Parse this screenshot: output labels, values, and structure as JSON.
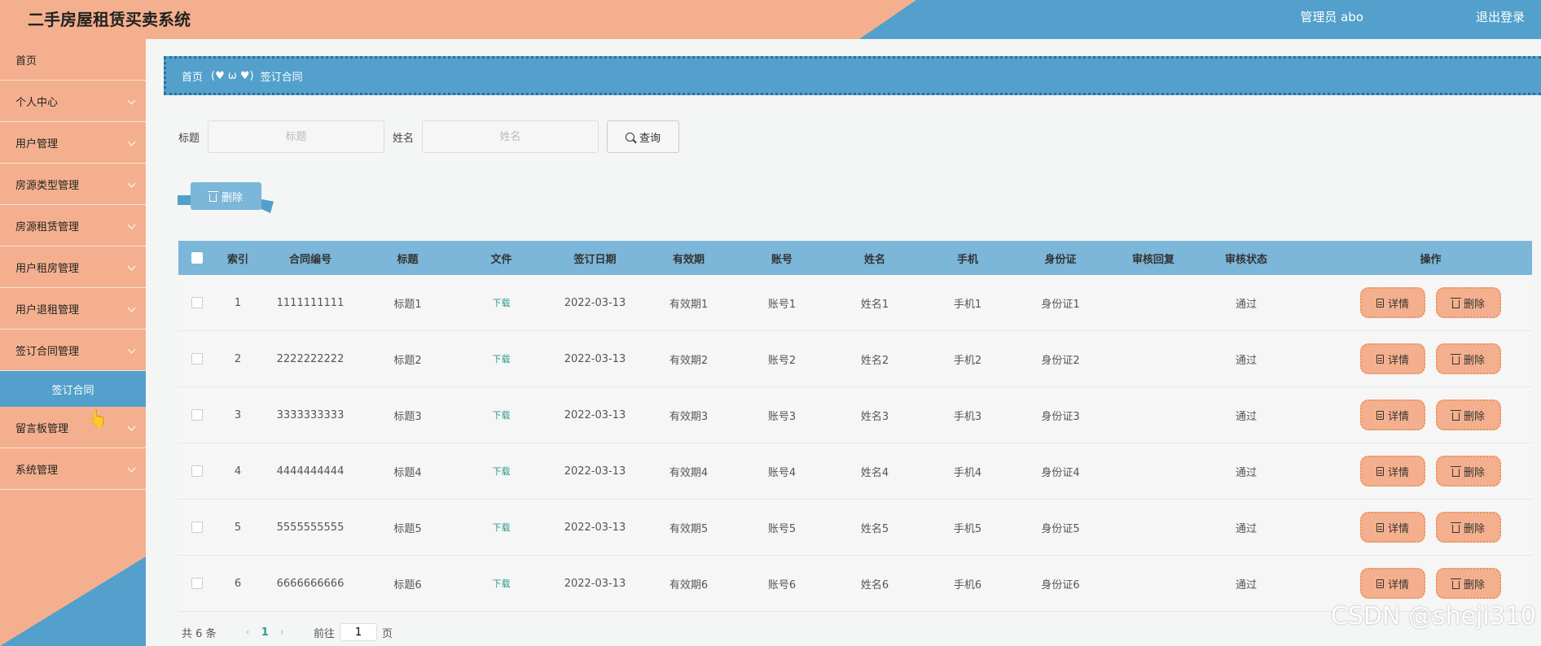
{
  "header": {
    "title": "二手房屋租赁买卖系统",
    "user": "管理员 abo",
    "logout": "退出登录"
  },
  "sidebar": {
    "items": [
      {
        "label": "首页",
        "has_children": false
      },
      {
        "label": "个人中心",
        "has_children": true
      },
      {
        "label": "用户管理",
        "has_children": true
      },
      {
        "label": "房源类型管理",
        "has_children": true
      },
      {
        "label": "房源租赁管理",
        "has_children": true
      },
      {
        "label": "用户租房管理",
        "has_children": true
      },
      {
        "label": "用户退租管理",
        "has_children": true
      },
      {
        "label": "签订合同管理",
        "has_children": true
      },
      {
        "label": "留言板管理",
        "has_children": true
      },
      {
        "label": "系统管理",
        "has_children": true
      }
    ],
    "active_sub": "签订合同"
  },
  "breadcrumb": {
    "home": "首页",
    "separator": "(♥ ω ♥)",
    "current": "签订合同"
  },
  "search": {
    "title_label": "标题",
    "title_placeholder": "标题",
    "name_label": "姓名",
    "name_placeholder": "姓名",
    "query_label": "查询"
  },
  "bulk_delete_label": "删除",
  "table": {
    "columns": [
      "索引",
      "合同编号",
      "标题",
      "文件",
      "签订日期",
      "有效期",
      "账号",
      "姓名",
      "手机",
      "身份证",
      "审核回复",
      "审核状态",
      "操作"
    ],
    "rows": [
      {
        "index": "1",
        "contract_no": "1111111111",
        "title": "标题1",
        "file": "下载",
        "date": "2022-03-13",
        "valid": "有效期1",
        "account": "账号1",
        "name": "姓名1",
        "phone": "手机1",
        "id_card": "身份证1",
        "reply": "",
        "status": "通过"
      },
      {
        "index": "2",
        "contract_no": "2222222222",
        "title": "标题2",
        "file": "下载",
        "date": "2022-03-13",
        "valid": "有效期2",
        "account": "账号2",
        "name": "姓名2",
        "phone": "手机2",
        "id_card": "身份证2",
        "reply": "",
        "status": "通过"
      },
      {
        "index": "3",
        "contract_no": "3333333333",
        "title": "标题3",
        "file": "下载",
        "date": "2022-03-13",
        "valid": "有效期3",
        "account": "账号3",
        "name": "姓名3",
        "phone": "手机3",
        "id_card": "身份证3",
        "reply": "",
        "status": "通过"
      },
      {
        "index": "4",
        "contract_no": "4444444444",
        "title": "标题4",
        "file": "下载",
        "date": "2022-03-13",
        "valid": "有效期4",
        "account": "账号4",
        "name": "姓名4",
        "phone": "手机4",
        "id_card": "身份证4",
        "reply": "",
        "status": "通过"
      },
      {
        "index": "5",
        "contract_no": "5555555555",
        "title": "标题5",
        "file": "下载",
        "date": "2022-03-13",
        "valid": "有效期5",
        "account": "账号5",
        "name": "姓名5",
        "phone": "手机5",
        "id_card": "身份证5",
        "reply": "",
        "status": "通过"
      },
      {
        "index": "6",
        "contract_no": "6666666666",
        "title": "标题6",
        "file": "下载",
        "date": "2022-03-13",
        "valid": "有效期6",
        "account": "账号6",
        "name": "姓名6",
        "phone": "手机6",
        "id_card": "身份证6",
        "reply": "",
        "status": "通过"
      }
    ],
    "detail_label": "详情",
    "delete_label": "删除"
  },
  "pagination": {
    "total": "共 6 条",
    "current_page": "1",
    "goto_prefix": "前往",
    "goto_value": "1",
    "goto_suffix": "页"
  },
  "watermark": "CSDN @sheji310",
  "colors": {
    "accent_orange": "#f4b08e",
    "accent_blue": "#52a0cb",
    "table_header": "#7cb6d8",
    "link_green": "#2a9c8a"
  }
}
